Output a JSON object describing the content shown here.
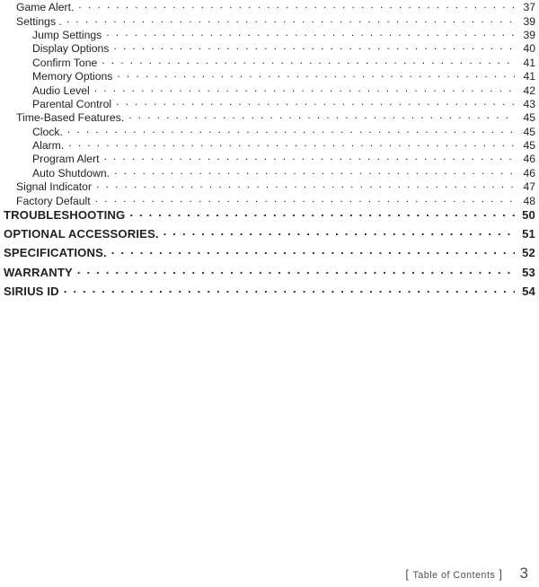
{
  "document": {
    "type": "table-of-contents"
  },
  "toc": {
    "rows": [
      {
        "label": "Game Alert.",
        "page": "37",
        "level": 1
      },
      {
        "label": "Settings .",
        "page": "39",
        "level": 1
      },
      {
        "label": "Jump Settings",
        "page": "39",
        "level": 2
      },
      {
        "label": "Display Options",
        "page": "40",
        "level": 2
      },
      {
        "label": "Confirm Tone",
        "page": "41",
        "level": 2
      },
      {
        "label": "Memory Options",
        "page": "41",
        "level": 2
      },
      {
        "label": "Audio Level",
        "page": "42",
        "level": 2
      },
      {
        "label": "Parental Control",
        "page": "43",
        "level": 2
      },
      {
        "label": "Time-Based Features.",
        "page": "45",
        "level": 1
      },
      {
        "label": "Clock.",
        "page": "45",
        "level": 2
      },
      {
        "label": "Alarm.",
        "page": "45",
        "level": 2
      },
      {
        "label": "Program Alert",
        "page": "46",
        "level": 2
      },
      {
        "label": "Auto Shutdown.",
        "page": "46",
        "level": 2
      },
      {
        "label": "Signal Indicator",
        "page": "47",
        "level": 1
      },
      {
        "label": "Factory Default",
        "page": "48",
        "level": 1
      },
      {
        "label": "TROUBLESHOOTING",
        "page": "50",
        "level": 0
      },
      {
        "label": "OPTIONAL ACCESSORIES.",
        "page": "51",
        "level": 0
      },
      {
        "label": "SPECIFICATIONS.",
        "page": "52",
        "level": 0
      },
      {
        "label": "WARRANTY",
        "page": "53",
        "level": 0
      },
      {
        "label": "SIRIUS ID",
        "page": "54",
        "level": 0
      }
    ]
  },
  "footer": {
    "bracket_open": "[",
    "label": "Table of Contents",
    "bracket_close": "]",
    "page_number": "3",
    "color": "#4d4d4d"
  }
}
